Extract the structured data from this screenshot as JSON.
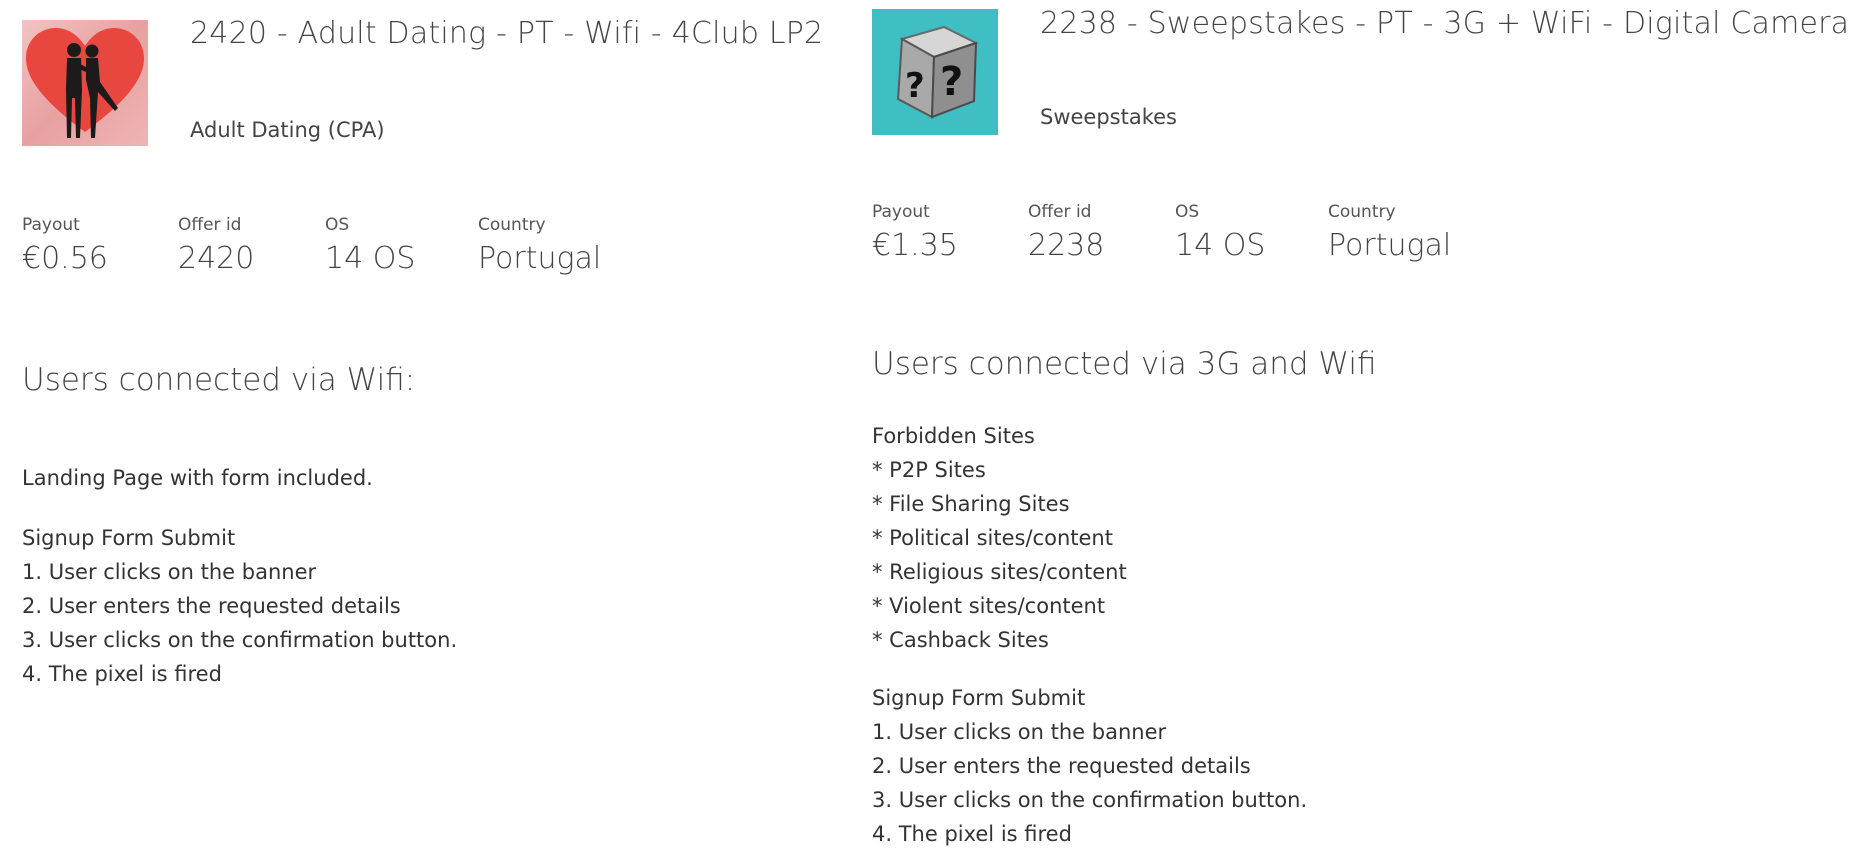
{
  "offers": [
    {
      "title": "2420 - Adult Dating - PT - Wifi - 4Club LP2",
      "category": "Adult Dating (CPA)",
      "thumbnail_icon": "couple-kissing-heart-icon",
      "stats": {
        "payout_label": "Payout",
        "payout_value": "€0.56",
        "offerid_label": "Offer id",
        "offerid_value": "2420",
        "os_label": "OS",
        "os_value": "14 OS",
        "country_label": "Country",
        "country_value": "Portugal"
      },
      "section_heading": "Users connected via Wifi:",
      "landing_note": "Landing Page with form included.",
      "flow_title": "Signup Form Submit",
      "flow_steps": [
        "1. User clicks on the banner",
        "2. User enters the requested details",
        "3. User clicks on the confirmation button.",
        "4. The pixel is fired"
      ]
    },
    {
      "title": "2238 - Sweepstakes - PT - 3G + WiFi - Digital Camera",
      "category": "Sweepstakes",
      "thumbnail_icon": "mystery-box-icon",
      "stats": {
        "payout_label": "Payout",
        "payout_value": "€1.35",
        "offerid_label": "Offer id",
        "offerid_value": "2238",
        "os_label": "OS",
        "os_value": "14 OS",
        "country_label": "Country",
        "country_value": "Portugal"
      },
      "section_heading": "Users connected via 3G and Wifi",
      "forbidden_title": "Forbidden Sites",
      "forbidden_items": [
        "* P2P Sites",
        "* File Sharing Sites",
        "* Political sites/content",
        "* Religious sites/content",
        "* Violent sites/content",
        "* Cashback Sites"
      ],
      "flow_title": "Signup Form Submit",
      "flow_steps": [
        "1. User clicks on the banner",
        "2. User enters the requested details",
        "3. User clicks on the confirmation button.",
        "4. The pixel is fired"
      ]
    }
  ],
  "colors": {
    "text": "#444444",
    "heart_bg": "#e7a1a1",
    "heart_red": "#e8473f",
    "box_bg": "#3fbfc4"
  }
}
